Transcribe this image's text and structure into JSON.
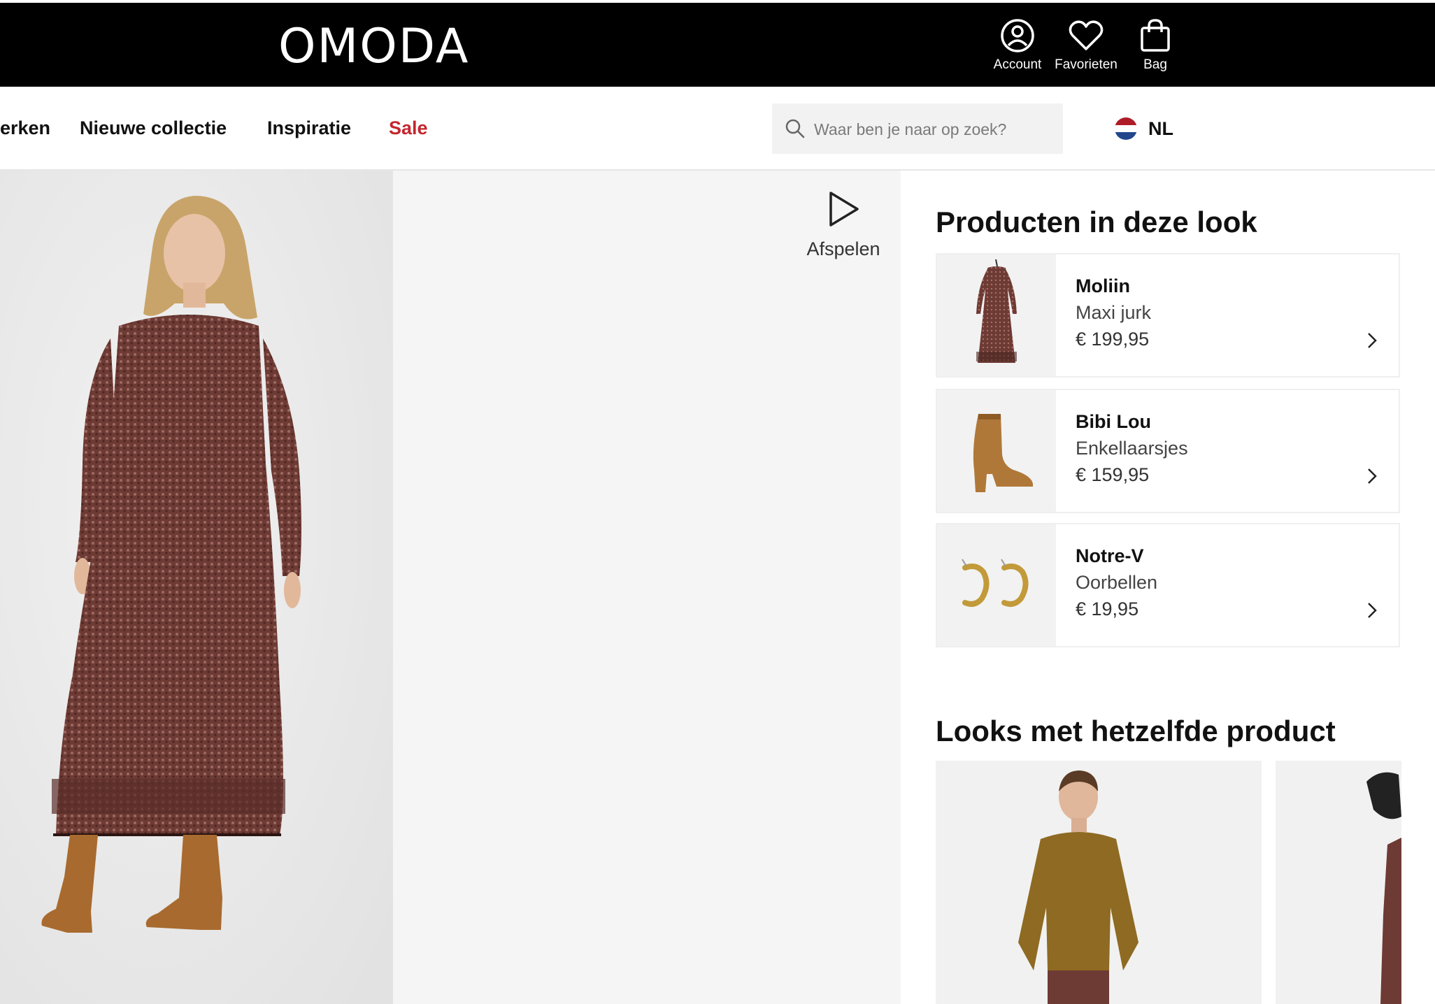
{
  "header": {
    "logo": "OMODA",
    "actions": [
      {
        "label": "Account",
        "icon": "account-icon"
      },
      {
        "label": "Favorieten",
        "icon": "heart-icon"
      },
      {
        "label": "Bag",
        "icon": "bag-icon"
      }
    ]
  },
  "nav": {
    "items": [
      {
        "label": "erken"
      },
      {
        "label": "Nieuwe collectie"
      },
      {
        "label": "Inspiratie"
      },
      {
        "label": "Sale"
      }
    ],
    "search_placeholder": "Waar ben je naar op zoek?",
    "language": "NL"
  },
  "hero": {
    "play_label": "Afspelen"
  },
  "panel": {
    "products_title": "Producten in deze look",
    "products": [
      {
        "brand": "Moliin",
        "type": "Maxi jurk",
        "price": "€ 199,95",
        "thumb": "dress"
      },
      {
        "brand": "Bibi Lou",
        "type": "Enkellaarsjes",
        "price": "€ 159,95",
        "thumb": "boot"
      },
      {
        "brand": "Notre-V",
        "type": "Oorbellen",
        "price": "€ 19,95",
        "thumb": "earrings"
      }
    ],
    "looks_title": "Looks met hetzelfde product"
  },
  "colors": {
    "sale": "#c4262e",
    "header_bg": "#000000",
    "flag": [
      "#ae1c28",
      "#ffffff",
      "#21468b"
    ]
  }
}
